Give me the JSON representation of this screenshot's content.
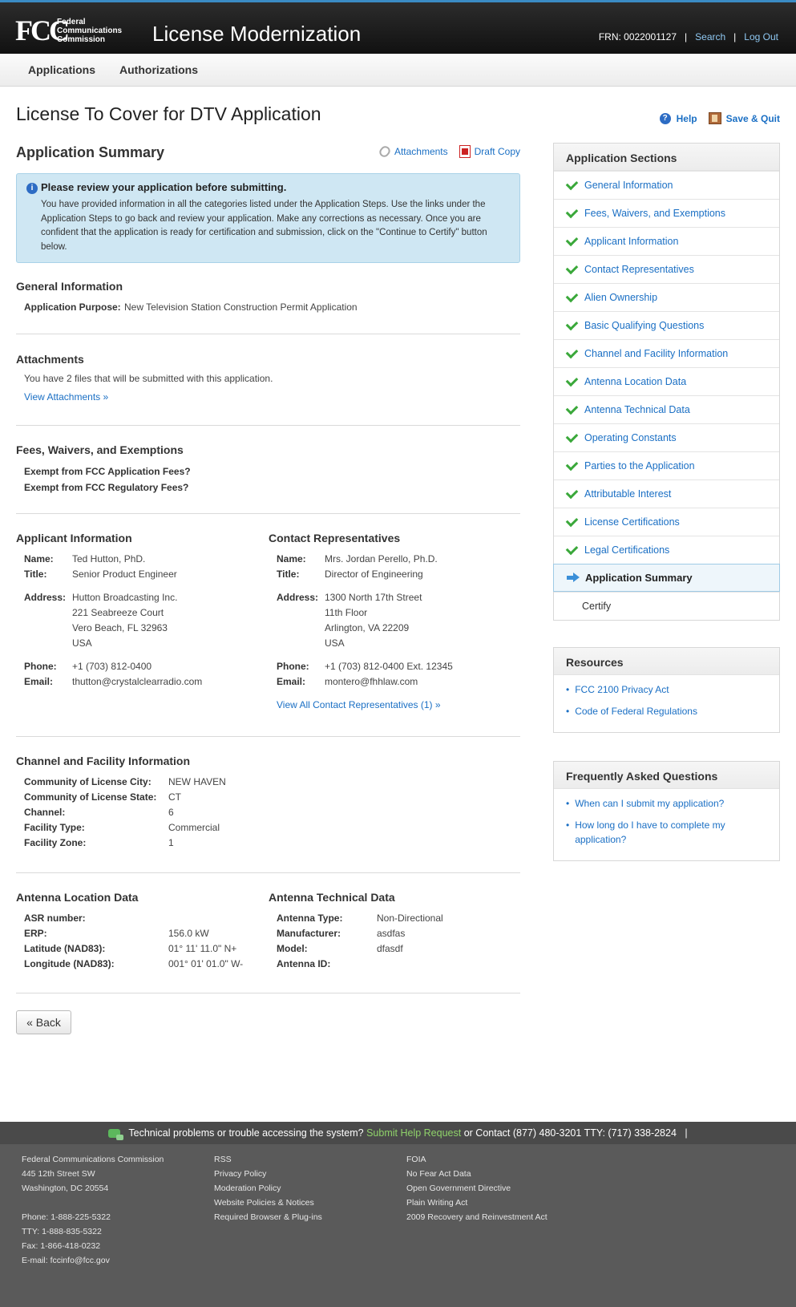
{
  "header": {
    "logo_mark": "FCC",
    "agency_lines": [
      "Federal",
      "Communications",
      "Commission"
    ],
    "app_title": "License Modernization",
    "frn": "FRN: 0022001127",
    "search": "Search",
    "logout": "Log Out"
  },
  "nav": {
    "items": [
      "Applications",
      "Authorizations"
    ]
  },
  "page": {
    "title": "License To Cover for DTV Application",
    "help": "Help",
    "save_quit": "Save & Quit"
  },
  "summary": {
    "title": "Application Summary",
    "attachments_link": "Attachments",
    "draft_copy_link": "Draft Copy",
    "notice_title": "Please review your application before submitting.",
    "notice_body": "You have provided information in all the categories listed under the Application Steps. Use the links under the Application Steps to go back and review your application. Make any corrections as necessary. Once you are confident that the application is ready for certification and submission, click on the \"Continue to Certify\" button below."
  },
  "general": {
    "heading": "General Information",
    "purpose_label": "Application Purpose:",
    "purpose_value": "New Television Station Construction Permit Application"
  },
  "attachments": {
    "heading": "Attachments",
    "text": "You have 2 files that will be submitted with this application.",
    "link": "View Attachments »"
  },
  "fees": {
    "heading": "Fees, Waivers, and Exemptions",
    "q1": "Exempt from FCC Application Fees?",
    "q2": "Exempt from FCC Regulatory Fees?"
  },
  "applicant": {
    "heading": "Applicant Information",
    "name_label": "Name:",
    "name": "Ted Hutton, PhD.",
    "title_label": "Title:",
    "title": "Senior Product Engineer",
    "address_label": "Address:",
    "address": [
      "Hutton Broadcasting Inc.",
      "221 Seabreeze Court",
      "Vero Beach, FL 32963",
      "USA"
    ],
    "phone_label": "Phone:",
    "phone": "+1 (703) 812-0400",
    "email_label": "Email:",
    "email": "thutton@crystalclearradio.com"
  },
  "contact": {
    "heading": "Contact Representatives",
    "name_label": "Name:",
    "name": "Mrs. Jordan Perello, Ph.D.",
    "title_label": "Title:",
    "title": "Director of Engineering",
    "address_label": "Address:",
    "address": [
      "1300 North 17th Street",
      "11th Floor",
      "Arlington, VA 22209",
      "USA"
    ],
    "phone_label": "Phone:",
    "phone": "+1 (703) 812-0400 Ext. 12345",
    "email_label": "Email:",
    "email": "montero@fhhlaw.com",
    "view_all": "View All Contact Representatives (1) »"
  },
  "channel": {
    "heading": "Channel and Facility Information",
    "rows": [
      {
        "k": "Community of License City:",
        "v": "NEW HAVEN"
      },
      {
        "k": "Community of License State:",
        "v": "CT"
      },
      {
        "k": "Channel:",
        "v": "6"
      },
      {
        "k": "Facility Type:",
        "v": "Commercial"
      },
      {
        "k": "Facility Zone:",
        "v": "1"
      }
    ]
  },
  "antenna_location": {
    "heading": "Antenna Location Data",
    "rows": [
      {
        "k": "ASR number:",
        "v": ""
      },
      {
        "k": "ERP:",
        "v": "156.0 kW"
      },
      {
        "k": "Latitude (NAD83):",
        "v": "01° 11' 11.0\" N+"
      },
      {
        "k": "Longitude (NAD83):",
        "v": "001° 01' 01.0\" W-"
      }
    ]
  },
  "antenna_technical": {
    "heading": "Antenna Technical Data",
    "rows": [
      {
        "k": "Antenna Type:",
        "v": "Non-Directional"
      },
      {
        "k": "Manufacturer:",
        "v": "asdfas"
      },
      {
        "k": "Model:",
        "v": "dfasdf"
      },
      {
        "k": "Antenna ID:",
        "v": ""
      }
    ]
  },
  "back_button": "« Back",
  "sections_panel": {
    "heading": "Application Sections",
    "items": [
      "General Information",
      "Fees, Waivers, and Exemptions",
      "Applicant Information",
      "Contact Representatives",
      "Alien Ownership",
      "Basic Qualifying Questions",
      "Channel and Facility Information",
      "Antenna Location Data",
      "Antenna Technical Data",
      "Operating Constants",
      "Parties to the Application",
      "Attributable Interest",
      "License Certifications",
      "Legal Certifications"
    ],
    "current": "Application Summary",
    "next": "Certify"
  },
  "resources": {
    "heading": "Resources",
    "items": [
      "FCC 2100 Privacy Act",
      "Code of Federal Regulations"
    ]
  },
  "faq": {
    "heading": "Frequently Asked Questions",
    "items": [
      "When can I submit my application?",
      "How long do I have to complete my application?"
    ]
  },
  "footer": {
    "tech_text": "Technical problems or trouble accessing the system?",
    "help_link": "Submit Help Request",
    "contact_text": "or Contact (877) 480-3201 TTY: (717) 338-2824",
    "pipe": "|",
    "col1": [
      "Federal Communications Commission",
      "445 12th Street SW",
      "Washington, DC 20554",
      "",
      "Phone: 1-888-225-5322",
      "TTY: 1-888-835-5322",
      "Fax: 1-866-418-0232",
      "E-mail: fccinfo@fcc.gov"
    ],
    "col2": [
      "RSS",
      "Privacy Policy",
      "Moderation Policy",
      "Website Policies & Notices",
      "Required Browser & Plug-ins"
    ],
    "col3": [
      "FOIA",
      "No Fear Act Data",
      "Open Government Directive",
      "Plain Writing Act",
      "2009 Recovery and Reinvestment Act"
    ]
  }
}
